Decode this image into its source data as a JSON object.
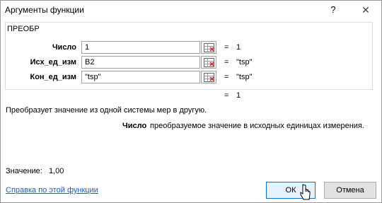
{
  "window": {
    "title": "Аргументы функции",
    "help_glyph": "?",
    "close_glyph": "✕"
  },
  "function": {
    "name": "ПРЕОБР",
    "args": [
      {
        "label": "Число",
        "value": "1",
        "result": "1"
      },
      {
        "label": "Исх_ед_изм",
        "value": "B2",
        "result": "\"tsp\""
      },
      {
        "label": "Кон_ед_изм",
        "value": "\"tsp\"",
        "result": "\"tsp\""
      }
    ],
    "equals": "=",
    "formula_result": "1",
    "description": "Преобразует значение из одной системы мер в другую.",
    "arg_help_name": "Число",
    "arg_help_text": "преобразуемое значение в исходных единицах измерения."
  },
  "footer": {
    "value_line": "Значение:   1,00",
    "help_link": "Справка по этой функции",
    "ok_label": "ОК",
    "cancel_label": "Отмена"
  }
}
